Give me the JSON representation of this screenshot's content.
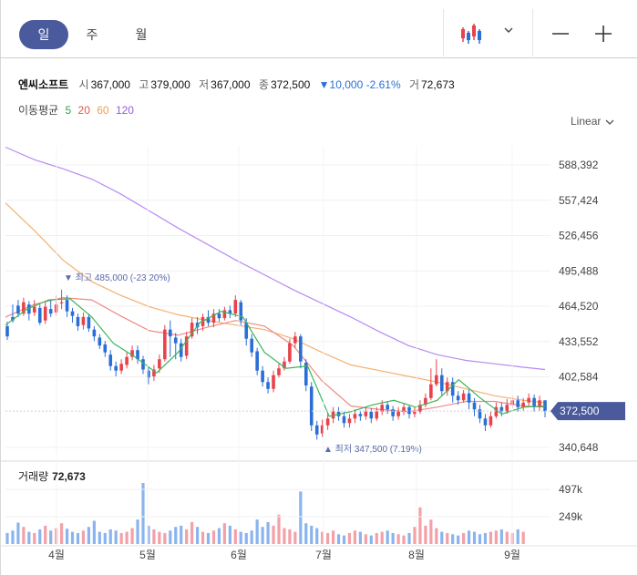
{
  "toolbar": {
    "tabs": [
      {
        "label": "일",
        "active": true
      },
      {
        "label": "주",
        "active": false
      },
      {
        "label": "월",
        "active": false
      }
    ],
    "chart_type_icon": "candlestick-icon",
    "dropdown_icon": "chevron-down-icon",
    "zoom_out_icon": "minus-icon",
    "zoom_in_icon": "plus-icon"
  },
  "quote": {
    "name": "엔씨소프트",
    "open_label": "시",
    "open": "367,000",
    "high_label": "고",
    "high": "379,000",
    "low_label": "저",
    "low": "367,000",
    "close_label": "종",
    "close": "372,500",
    "change": "▼10,000 -2.61%",
    "volume_label": "거",
    "volume": "72,673"
  },
  "moving_average": {
    "label": "이동평균",
    "periods": [
      {
        "value": "5",
        "color": "#27a844"
      },
      {
        "value": "20",
        "color": "#e8564a"
      },
      {
        "value": "60",
        "color": "#f0a050"
      },
      {
        "value": "120",
        "color": "#9b59e6"
      }
    ]
  },
  "scale_mode": "Linear",
  "colors": {
    "up": "#e8434b",
    "down": "#2a6fd6",
    "accent": "#4a5a9c",
    "volume_up": "#f4a0a7",
    "volume_down": "#8ab4ee"
  },
  "chart_data": {
    "type": "candlestick",
    "y_ticks": [
      "588,392",
      "557,424",
      "526,456",
      "495,488",
      "464,520",
      "433,552",
      "402,584",
      "340,648"
    ],
    "y_tick_values": [
      588392,
      557424,
      526456,
      495488,
      464520,
      433552,
      402584,
      340648
    ],
    "current_price_tag": "372,500",
    "max_annotation": "최고 485,000 (-23.20%)",
    "min_annotation": "최저 347,500 (7.19%)",
    "x_labels": [
      "4월",
      "5월",
      "6월",
      "7월",
      "8월",
      "9월"
    ],
    "ylim": [
      330000,
      610000
    ],
    "ma120": [
      [
        0,
        604000
      ],
      [
        8,
        593000
      ],
      [
        16,
        585000
      ],
      [
        24,
        576000
      ],
      [
        32,
        563000
      ],
      [
        40,
        548000
      ],
      [
        48,
        533000
      ],
      [
        56,
        519000
      ],
      [
        64,
        505000
      ],
      [
        72,
        492000
      ],
      [
        80,
        479000
      ],
      [
        88,
        467000
      ],
      [
        96,
        455000
      ],
      [
        104,
        442000
      ],
      [
        112,
        430000
      ],
      [
        120,
        422000
      ],
      [
        128,
        417000
      ],
      [
        136,
        414000
      ],
      [
        144,
        411000
      ],
      [
        150,
        409000
      ]
    ],
    "ma60": [
      [
        0,
        555000
      ],
      [
        8,
        531000
      ],
      [
        16,
        505000
      ],
      [
        24,
        486000
      ],
      [
        32,
        474000
      ],
      [
        40,
        464000
      ],
      [
        48,
        457000
      ],
      [
        56,
        452000
      ],
      [
        64,
        448000
      ],
      [
        72,
        444000
      ],
      [
        80,
        436000
      ],
      [
        88,
        424000
      ],
      [
        96,
        413000
      ],
      [
        104,
        408000
      ],
      [
        112,
        403000
      ],
      [
        120,
        398000
      ],
      [
        128,
        392000
      ],
      [
        136,
        386000
      ],
      [
        144,
        382000
      ],
      [
        150,
        380000
      ]
    ],
    "ma20": [
      [
        0,
        455000
      ],
      [
        8,
        466000
      ],
      [
        16,
        472000
      ],
      [
        24,
        470000
      ],
      [
        32,
        456000
      ],
      [
        40,
        443000
      ],
      [
        48,
        439000
      ],
      [
        56,
        446000
      ],
      [
        64,
        452000
      ],
      [
        72,
        447000
      ],
      [
        80,
        430000
      ],
      [
        88,
        399000
      ],
      [
        96,
        377000
      ],
      [
        104,
        374000
      ],
      [
        112,
        372000
      ],
      [
        120,
        376000
      ],
      [
        128,
        381000
      ],
      [
        136,
        381000
      ],
      [
        144,
        377000
      ],
      [
        150,
        376000
      ]
    ],
    "ma5": [
      [
        0,
        448000
      ],
      [
        6,
        462000
      ],
      [
        12,
        470000
      ],
      [
        18,
        471000
      ],
      [
        24,
        455000
      ],
      [
        30,
        432000
      ],
      [
        36,
        420000
      ],
      [
        42,
        406000
      ],
      [
        48,
        424000
      ],
      [
        54,
        450000
      ],
      [
        60,
        460000
      ],
      [
        66,
        455000
      ],
      [
        72,
        424000
      ],
      [
        78,
        410000
      ],
      [
        84,
        412000
      ],
      [
        90,
        368000
      ],
      [
        96,
        372000
      ],
      [
        102,
        378000
      ],
      [
        108,
        382000
      ],
      [
        114,
        376000
      ],
      [
        120,
        382000
      ],
      [
        126,
        400000
      ],
      [
        132,
        384000
      ],
      [
        138,
        370000
      ],
      [
        144,
        376000
      ],
      [
        150,
        377000
      ]
    ],
    "candles": [
      [
        447000,
        438000,
        451000,
        435000
      ],
      [
        455000,
        452000,
        466000,
        450000
      ],
      [
        465000,
        458000,
        470000,
        455000
      ],
      [
        458000,
        468000,
        472000,
        456000
      ],
      [
        466000,
        458000,
        469000,
        452000
      ],
      [
        459000,
        464000,
        470000,
        456000
      ],
      [
        463000,
        450000,
        466000,
        448000
      ],
      [
        452000,
        464000,
        468000,
        449000
      ],
      [
        462000,
        458000,
        470000,
        455000
      ],
      [
        459000,
        466000,
        474000,
        456000
      ],
      [
        467000,
        468000,
        479000,
        462000
      ],
      [
        470000,
        460000,
        474000,
        455000
      ],
      [
        460000,
        456000,
        463000,
        450000
      ],
      [
        455000,
        447000,
        458000,
        443000
      ],
      [
        448000,
        455000,
        459000,
        444000
      ],
      [
        455000,
        445000,
        458000,
        442000
      ],
      [
        444000,
        438000,
        447000,
        434000
      ],
      [
        437000,
        430000,
        440000,
        427000
      ],
      [
        431000,
        424000,
        434000,
        420000
      ],
      [
        422000,
        412000,
        426000,
        408000
      ],
      [
        412000,
        408000,
        416000,
        403000
      ],
      [
        408000,
        414000,
        418000,
        405000
      ],
      [
        413000,
        420000,
        424000,
        410000
      ],
      [
        420000,
        426000,
        430000,
        417000
      ],
      [
        426000,
        418000,
        430000,
        414000
      ],
      [
        418000,
        409000,
        421000,
        405000
      ],
      [
        408000,
        402000,
        411000,
        396000
      ],
      [
        403000,
        409000,
        413000,
        399000
      ],
      [
        410000,
        418000,
        422000,
        406000
      ],
      [
        418000,
        444000,
        448000,
        416000
      ],
      [
        444000,
        438000,
        452000,
        420000
      ],
      [
        437000,
        432000,
        441000,
        418000
      ],
      [
        432000,
        420000,
        436000,
        416000
      ],
      [
        421000,
        438000,
        442000,
        418000
      ],
      [
        438000,
        450000,
        454000,
        436000
      ],
      [
        450000,
        446000,
        455000,
        440000
      ],
      [
        447000,
        455000,
        458000,
        443000
      ],
      [
        455000,
        450000,
        461000,
        447000
      ],
      [
        450000,
        458000,
        462000,
        446000
      ],
      [
        458000,
        454000,
        462000,
        451000
      ],
      [
        454000,
        461000,
        464000,
        452000
      ],
      [
        461000,
        458000,
        465000,
        454000
      ],
      [
        458000,
        470000,
        474000,
        455000
      ],
      [
        468000,
        452000,
        470000,
        448000
      ],
      [
        450000,
        436000,
        454000,
        430000
      ],
      [
        436000,
        424000,
        440000,
        420000
      ],
      [
        425000,
        408000,
        428000,
        404000
      ],
      [
        408000,
        398000,
        412000,
        394000
      ],
      [
        398000,
        392000,
        402000,
        388000
      ],
      [
        392000,
        404000,
        408000,
        389000
      ],
      [
        404000,
        410000,
        414000,
        402000
      ],
      [
        410000,
        416000,
        420000,
        408000
      ],
      [
        416000,
        432000,
        436000,
        414000
      ],
      [
        432000,
        438000,
        442000,
        428000
      ],
      [
        438000,
        416000,
        440000,
        410000
      ],
      [
        415000,
        395000,
        418000,
        390000
      ],
      [
        394000,
        360000,
        398000,
        355000
      ],
      [
        360000,
        352000,
        364000,
        347500
      ],
      [
        353000,
        360000,
        365000,
        350000
      ],
      [
        360000,
        366000,
        370000,
        356000
      ],
      [
        366000,
        372000,
        376000,
        362000
      ],
      [
        372000,
        368000,
        376000,
        364000
      ],
      [
        368000,
        362000,
        372000,
        358000
      ],
      [
        362000,
        366000,
        370000,
        358000
      ],
      [
        366000,
        370000,
        374000,
        362000
      ],
      [
        370000,
        368000,
        373000,
        364000
      ],
      [
        368000,
        372000,
        376000,
        365000
      ],
      [
        372000,
        366000,
        375000,
        362000
      ],
      [
        366000,
        372000,
        376000,
        364000
      ],
      [
        372000,
        378000,
        382000,
        369000
      ],
      [
        378000,
        374000,
        381000,
        370000
      ],
      [
        374000,
        368000,
        377000,
        364000
      ],
      [
        368000,
        372000,
        376000,
        365000
      ],
      [
        372000,
        376000,
        379000,
        369000
      ],
      [
        376000,
        370000,
        378000,
        366000
      ],
      [
        370000,
        372000,
        376000,
        367000
      ],
      [
        372000,
        378000,
        382000,
        370000
      ],
      [
        378000,
        384000,
        388000,
        376000
      ],
      [
        384000,
        396000,
        410000,
        382000
      ],
      [
        396000,
        404000,
        418000,
        394000
      ],
      [
        404000,
        390000,
        410000,
        386000
      ],
      [
        390000,
        398000,
        402000,
        386000
      ],
      [
        398000,
        386000,
        402000,
        380000
      ],
      [
        386000,
        382000,
        390000,
        378000
      ],
      [
        382000,
        388000,
        391000,
        380000
      ],
      [
        388000,
        380000,
        391000,
        374000
      ],
      [
        380000,
        374000,
        384000,
        368000
      ],
      [
        374000,
        366000,
        378000,
        362000
      ],
      [
        366000,
        360000,
        370000,
        355000
      ],
      [
        360000,
        368000,
        372000,
        358000
      ],
      [
        368000,
        376000,
        380000,
        366000
      ],
      [
        376000,
        372000,
        380000,
        368000
      ],
      [
        372000,
        378000,
        383000,
        370000
      ],
      [
        378000,
        382000,
        386000,
        375000
      ],
      [
        382000,
        376000,
        386000,
        372000
      ],
      [
        376000,
        380000,
        384000,
        373000
      ],
      [
        380000,
        384000,
        388000,
        377000
      ],
      [
        384000,
        376000,
        387000,
        372000
      ],
      [
        376000,
        382000,
        386000,
        373000
      ],
      [
        382000,
        372500,
        379000,
        367000
      ]
    ],
    "volumes": [
      18,
      22,
      35,
      28,
      20,
      18,
      24,
      30,
      22,
      26,
      34,
      25,
      20,
      18,
      22,
      28,
      38,
      20,
      18,
      24,
      22,
      18,
      20,
      26,
      40,
      100,
      30,
      24,
      20,
      18,
      22,
      28,
      30,
      24,
      36,
      28,
      20,
      18,
      22,
      26,
      34,
      30,
      24,
      20,
      18,
      22,
      40,
      28,
      36,
      30,
      48,
      26,
      24,
      20,
      86,
      34,
      30,
      26,
      20,
      18,
      22,
      16,
      14,
      18,
      22,
      20,
      16,
      14,
      18,
      20,
      22,
      18,
      16,
      14,
      18,
      28,
      60,
      30,
      40,
      26,
      20,
      18,
      16,
      14,
      18,
      22,
      20,
      16,
      18,
      20,
      22,
      24,
      20,
      18,
      24,
      20
    ],
    "volume_ticks": [
      "497k",
      "249k"
    ]
  },
  "volume_panel": {
    "label": "거래량",
    "value": "72,673"
  }
}
